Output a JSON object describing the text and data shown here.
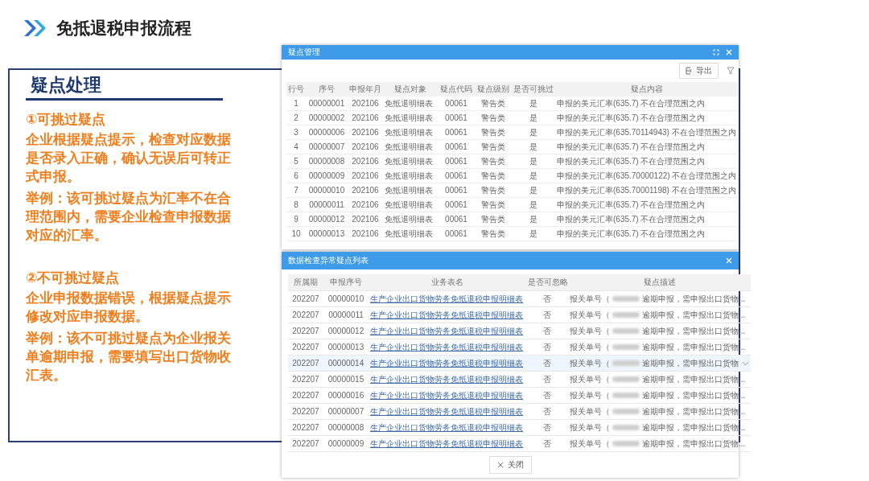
{
  "slide": {
    "title": "免抵退税申报流程"
  },
  "note": {
    "heading": "疑点处理",
    "sections": [
      {
        "title": "①可挑过疑点",
        "body": "企业根据疑点提示，检查对应数据是否录入正确，确认无误后可转正式申报。",
        "example": "举例：该可挑过疑点为汇率不在合理范围内，需要企业检查申报数据对应的汇率。"
      },
      {
        "title": "②不可挑过疑点",
        "body": "企业申报数据错误，根据疑点提示修改对应申报数据。",
        "example": "举例：该不可挑过疑点为企业报关单逾期申报，需要填写出口货物收汇表。"
      }
    ]
  },
  "windows": [
    {
      "kind": "manage",
      "title": "疑点管理",
      "export_button": "导出",
      "columns": [
        "行号",
        "序号",
        "申报年月",
        "疑点对象",
        "疑点代码",
        "疑点级别",
        "是否可挑过",
        "疑点内容"
      ],
      "rows": [
        {
          "cells": [
            "1",
            "00000001",
            "202106",
            "免抵退明细表",
            "00061",
            "警告类",
            "是",
            "申报的美元汇率(635.7) 不在合理范围之内"
          ]
        },
        {
          "cells": [
            "2",
            "00000002",
            "202106",
            "免抵退明细表",
            "00061",
            "警告类",
            "是",
            "申报的美元汇率(635.7) 不在合理范围之内"
          ]
        },
        {
          "cells": [
            "3",
            "00000006",
            "202106",
            "免抵退明细表",
            "00061",
            "警告类",
            "是",
            "申报的美元汇率(635.70114943) 不在合理范围之内"
          ]
        },
        {
          "cells": [
            "4",
            "00000007",
            "202106",
            "免抵退明细表",
            "00061",
            "警告类",
            "是",
            "申报的美元汇率(635.7) 不在合理范围之内"
          ]
        },
        {
          "cells": [
            "5",
            "00000008",
            "202106",
            "免抵退明细表",
            "00061",
            "警告类",
            "是",
            "申报的美元汇率(635.7) 不在合理范围之内"
          ]
        },
        {
          "cells": [
            "6",
            "00000009",
            "202106",
            "免抵退明细表",
            "00061",
            "警告类",
            "是",
            "申报的美元汇率(635.70000122) 不在合理范围之内"
          ]
        },
        {
          "cells": [
            "7",
            "00000010",
            "202106",
            "免抵退明细表",
            "00061",
            "警告类",
            "是",
            "申报的美元汇率(635.70001198) 不在合理范围之内"
          ]
        },
        {
          "cells": [
            "8",
            "00000011",
            "202106",
            "免抵退明细表",
            "00061",
            "警告类",
            "是",
            "申报的美元汇率(635.7) 不在合理范围之内"
          ]
        },
        {
          "cells": [
            "9",
            "00000012",
            "202106",
            "免抵退明细表",
            "00061",
            "警告类",
            "是",
            "申报的美元汇率(635.7) 不在合理范围之内"
          ]
        },
        {
          "cells": [
            "10",
            "00000013",
            "202106",
            "免抵退明细表",
            "00061",
            "警告类",
            "是",
            "申报的美元汇率(635.7) 不在合理范围之内"
          ]
        }
      ]
    },
    {
      "kind": "check",
      "title": "数据检查异常疑点列表",
      "close_button": "关闭",
      "columns": [
        "所属期",
        "申报序号",
        "业务表名",
        "是否可忽略",
        "疑点描述"
      ],
      "rows": [
        {
          "cells": [
            "202207",
            "00000010",
            "生产企业出口货物劳务免抵退税申报明细表",
            "否"
          ],
          "desc_start": "报关单号（",
          "desc_end": "逾期申报，需申报出口货物...",
          "selected": false
        },
        {
          "cells": [
            "202207",
            "00000011",
            "生产企业出口货物劳务免抵退税申报明细表",
            "否"
          ],
          "desc_start": "报关单号（",
          "desc_end": "逾期申报，需申报出口货物...",
          "selected": false
        },
        {
          "cells": [
            "202207",
            "00000012",
            "生产企业出口货物劳务免抵退税申报明细表",
            "否"
          ],
          "desc_start": "报关单号（",
          "desc_end": "逾期申报，需申报出口货物...",
          "selected": false
        },
        {
          "cells": [
            "202207",
            "00000013",
            "生产企业出口货物劳务免抵退税申报明细表",
            "否"
          ],
          "desc_start": "报关单号（",
          "desc_end": "逾期申报，需申报出口货物...",
          "selected": false
        },
        {
          "cells": [
            "202207",
            "00000014",
            "生产企业出口货物劳务免抵退税申报明细表",
            "否"
          ],
          "desc_start": "报关单号（",
          "desc_end": "逾期申报，需申报出口货物",
          "selected": true
        },
        {
          "cells": [
            "202207",
            "00000015",
            "生产企业出口货物劳务免抵退税申报明细表",
            "否"
          ],
          "desc_start": "报关单号（",
          "desc_end": "逾期申报，需申报出口货物...",
          "selected": false
        },
        {
          "cells": [
            "202207",
            "00000016",
            "生产企业出口货物劳务免抵退税申报明细表",
            "否"
          ],
          "desc_start": "报关单号（",
          "desc_end": "逾期申报，需申报出口货物...",
          "selected": false
        },
        {
          "cells": [
            "202207",
            "00000007",
            "生产企业出口货物劳务免抵退税申报明细表",
            "否"
          ],
          "desc_start": "报关单号（",
          "desc_end": "逾期申报，需申报出口货物...",
          "selected": false
        },
        {
          "cells": [
            "202207",
            "00000008",
            "生产企业出口货物劳务免抵退税申报明细表",
            "否"
          ],
          "desc_start": "报关单号（",
          "desc_end": "逾期申报，需申报出口货物...",
          "selected": false
        },
        {
          "cells": [
            "202207",
            "00000009",
            "生产企业出口货物劳务免抵退税申报明细表",
            "否"
          ],
          "desc_start": "报关单号（",
          "desc_end": "逾期申报，需申报出口货物...",
          "selected": false
        }
      ]
    }
  ]
}
